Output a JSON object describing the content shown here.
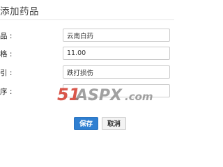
{
  "page": {
    "title": "添加药品"
  },
  "form": {
    "rows": [
      {
        "label": "品 :",
        "value": "云南白药"
      },
      {
        "label": "格 :",
        "value": "11.00"
      },
      {
        "label": "引 :",
        "value": "跌打损伤"
      },
      {
        "label": "序 :",
        "value": ""
      }
    ]
  },
  "buttons": {
    "save": "保存",
    "cancel": "取消"
  },
  "watermark": {
    "number": "51",
    "brand": "ASPX",
    "suffix": ".com"
  },
  "colors": {
    "primary": "#2f7fd1",
    "watermark_red": "#d23a2b",
    "watermark_gray": "#8a8a8a"
  }
}
